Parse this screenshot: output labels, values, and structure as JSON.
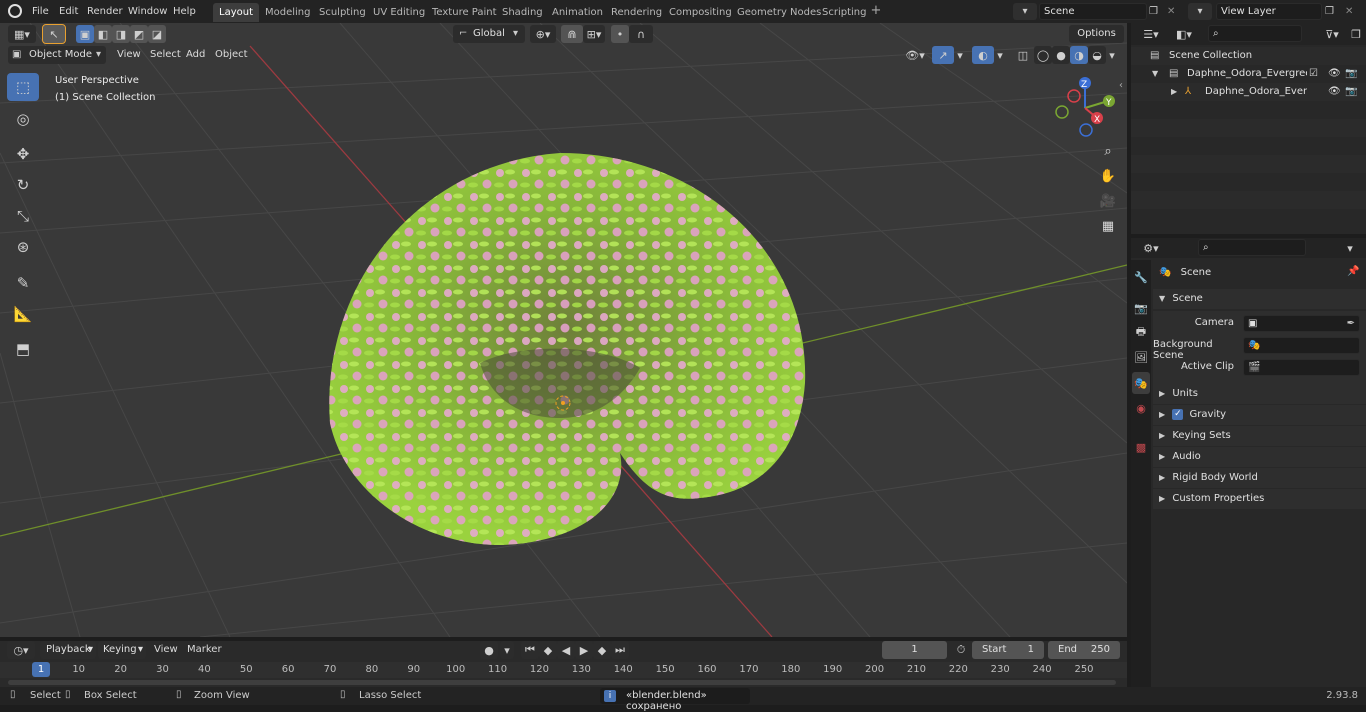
{
  "menu": {
    "file": "File",
    "edit": "Edit",
    "render": "Render",
    "window": "Window",
    "help": "Help"
  },
  "workspaces": [
    "Layout",
    "Modeling",
    "Sculpting",
    "UV Editing",
    "Texture Paint",
    "Shading",
    "Animation",
    "Rendering",
    "Compositing",
    "Geometry Nodes",
    "Scripting"
  ],
  "scene_field": "Scene",
  "view_layer_field": "View Layer",
  "viewport_header": {
    "orientation": "Global",
    "options": "Options",
    "mode": "Object Mode",
    "view": "View",
    "select": "Select",
    "add": "Add",
    "object": "Object"
  },
  "overlay_text": {
    "perspective": "User Perspective",
    "collection": "(1) Scene Collection"
  },
  "gizmo": {
    "z": "Z",
    "y": "Y",
    "x": "X"
  },
  "outliner": {
    "root": "Scene Collection",
    "item1": "Daphne_Odora_Evergreen_Sh",
    "item2": "Daphne_Odora_Evergree"
  },
  "properties": {
    "context": "Scene",
    "panel": "Scene",
    "camera_label": "Camera",
    "bg_label": "Background Scene",
    "clip_label": "Active Clip",
    "sections": [
      "Units",
      "Gravity",
      "Keying Sets",
      "Audio",
      "Rigid Body World",
      "Custom Properties"
    ],
    "gravity_checked": true
  },
  "timeline": {
    "playback": "Playback",
    "keying": "Keying",
    "view": "View",
    "marker": "Marker",
    "current_frame": "1",
    "start_label": "Start",
    "start": "1",
    "end_label": "End",
    "end": "250",
    "ticks": [
      "1",
      "10",
      "20",
      "30",
      "40",
      "50",
      "60",
      "70",
      "80",
      "90",
      "100",
      "110",
      "120",
      "130",
      "140",
      "150",
      "160",
      "170",
      "180",
      "190",
      "200",
      "210",
      "220",
      "230",
      "240",
      "250"
    ]
  },
  "status": {
    "select": "Select",
    "box": "Box Select",
    "zoom": "Zoom View",
    "lasso": "Lasso Select",
    "message": "«blender.blend» сохранено",
    "version": "2.93.8"
  },
  "colors": {
    "accent": "#4772b3",
    "leaf": "#9bd23c",
    "flower": "#e6a9cf",
    "x_axis": "#b0343d",
    "y_axis": "#7aa02a"
  }
}
